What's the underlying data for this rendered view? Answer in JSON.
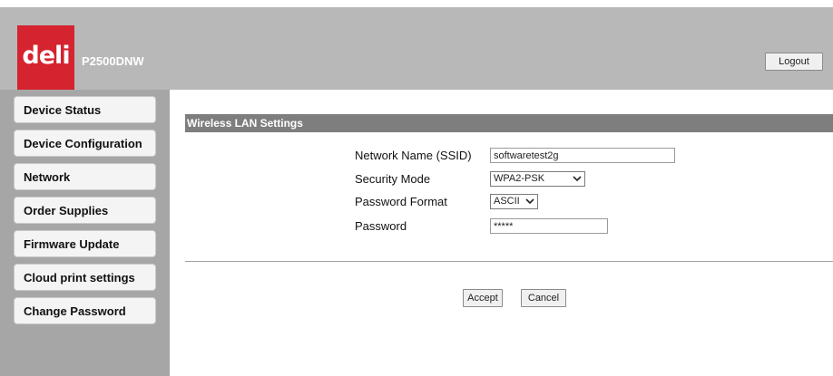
{
  "header": {
    "logo_text": "deli",
    "model": "P2500DNW",
    "logout_label": "Logout",
    "colors": {
      "logo_red": "#d5232f",
      "header_gray": "#b8b8b8"
    }
  },
  "sidebar": {
    "items": [
      {
        "label": "Device Status"
      },
      {
        "label": "Device Configuration"
      },
      {
        "label": "Network"
      },
      {
        "label": "Order Supplies"
      },
      {
        "label": "Firmware Update"
      },
      {
        "label": "Cloud print settings"
      },
      {
        "label": "Change Password"
      }
    ]
  },
  "main": {
    "section_title": "Wireless LAN Settings",
    "fields": {
      "ssid": {
        "label": "Network Name (SSID)",
        "value": "softwaretest2g"
      },
      "security": {
        "label": "Security Mode",
        "value": "WPA2-PSK",
        "icon": "chevron-down-icon"
      },
      "format": {
        "label": "Password Format",
        "value": "ASCII",
        "icon": "chevron-down-icon"
      },
      "password": {
        "label": "Password",
        "value": "*****"
      }
    },
    "buttons": {
      "accept": "Accept",
      "cancel": "Cancel"
    }
  }
}
